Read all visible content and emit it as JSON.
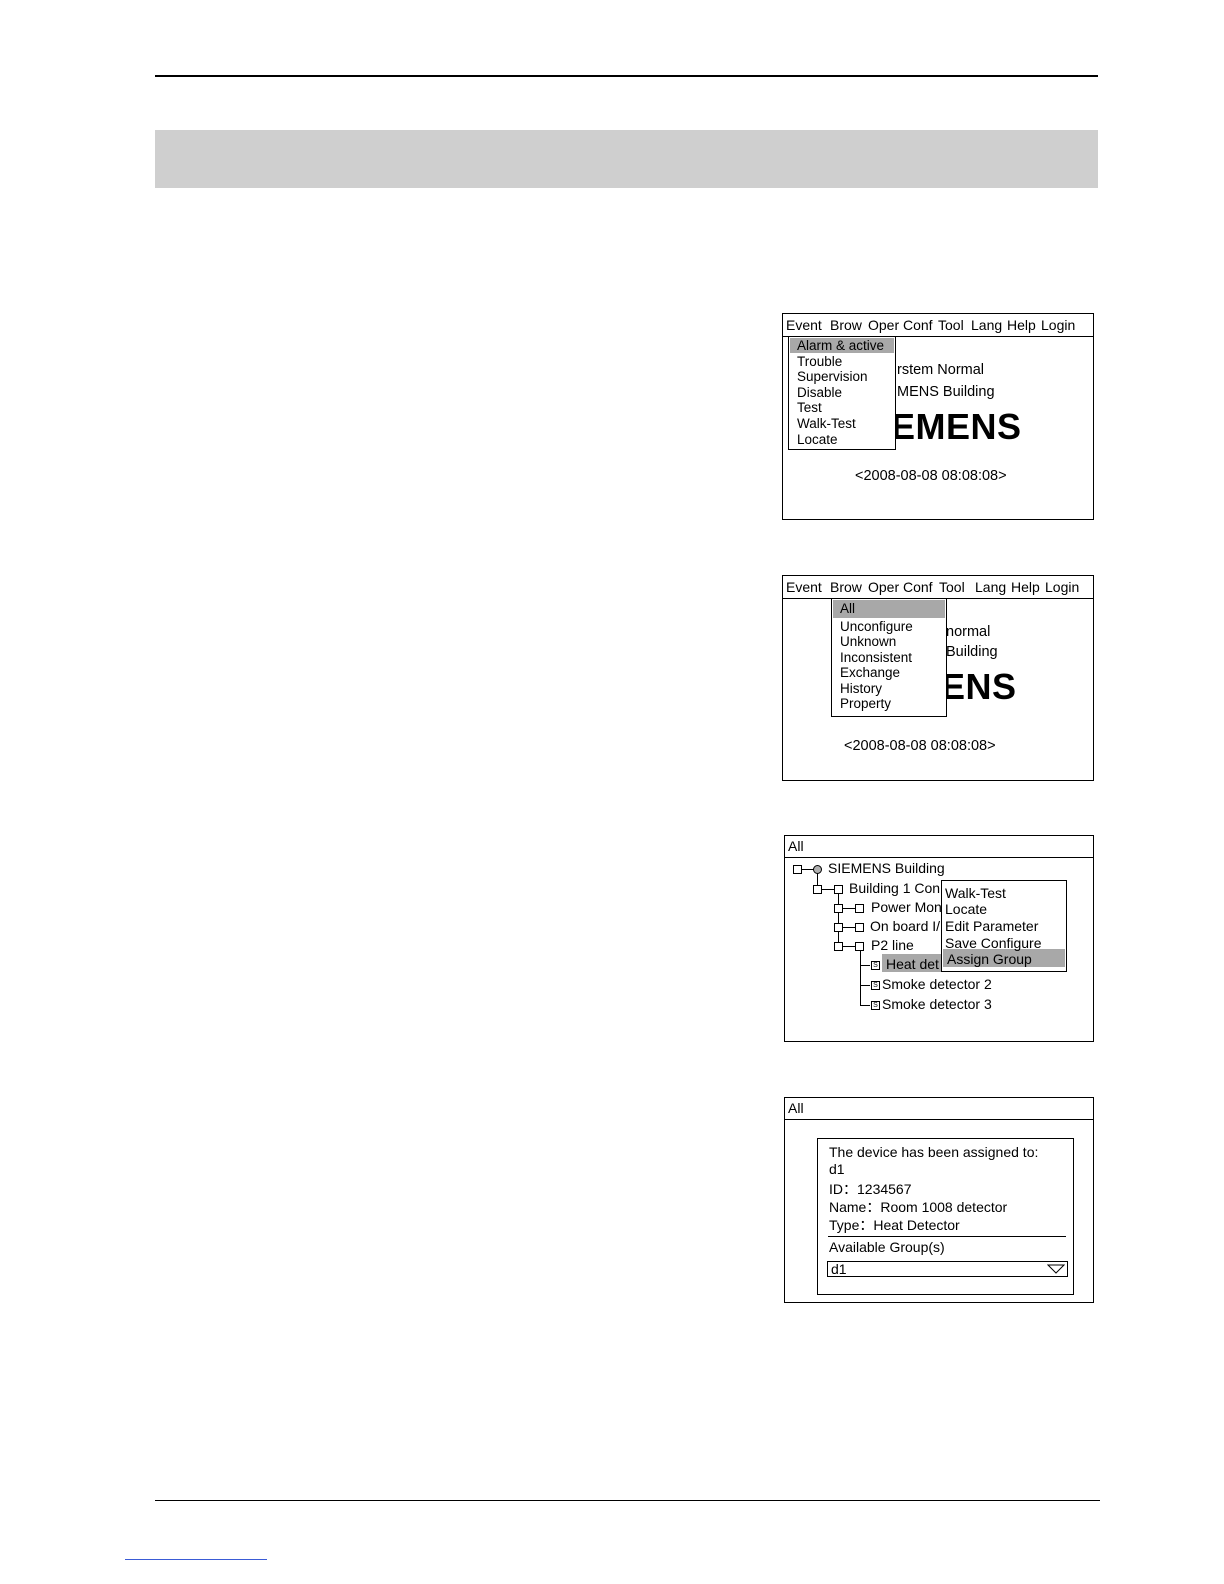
{
  "screen1": {
    "menu": [
      "Event",
      "Brow",
      "Oper",
      "Conf",
      "Tool",
      "Lang",
      "Help",
      "Login"
    ],
    "status": "rstem Normal",
    "building": "MENS Building",
    "brand": "EMENS",
    "datetime": "<2008-08-08   08:08:08>",
    "dropdown": [
      "Alarm & active",
      "Trouble",
      "Supervision",
      "Disable",
      "Test",
      "Walk-Test",
      "Locate"
    ]
  },
  "screen2": {
    "menu": [
      "Event",
      "Brow",
      "Oper",
      "Conf",
      "Tool",
      "Lang",
      "Help",
      "Login"
    ],
    "status": "normal",
    "building": "Building",
    "brand": "ENS",
    "datetime": "<2008-08-08   08:08:08>",
    "dropdown": [
      "All",
      "Unconfigure",
      "Unknown",
      "Inconsistent",
      "Exchange",
      "History",
      "Property"
    ]
  },
  "screen3": {
    "title": "All",
    "tree": [
      "SIEMENS Building",
      "Building 1 Con",
      "Power Mon",
      "On board I/",
      "P2 line",
      "Heat det",
      "Smoke detector 2",
      "Smoke detector 3"
    ],
    "context_menu": [
      "Walk-Test",
      "Locate",
      "Edit Parameter",
      "Save Configure",
      "Assign Group"
    ]
  },
  "screen4": {
    "title": "All",
    "dialog": {
      "heading": "The device has been assigned to:",
      "group": "d1",
      "id": "ID：1234567",
      "name": "Name：Room 1008 detector",
      "type": "Type：Heat Detector",
      "available_label": "Available Group(s)",
      "selected": "d1"
    }
  }
}
